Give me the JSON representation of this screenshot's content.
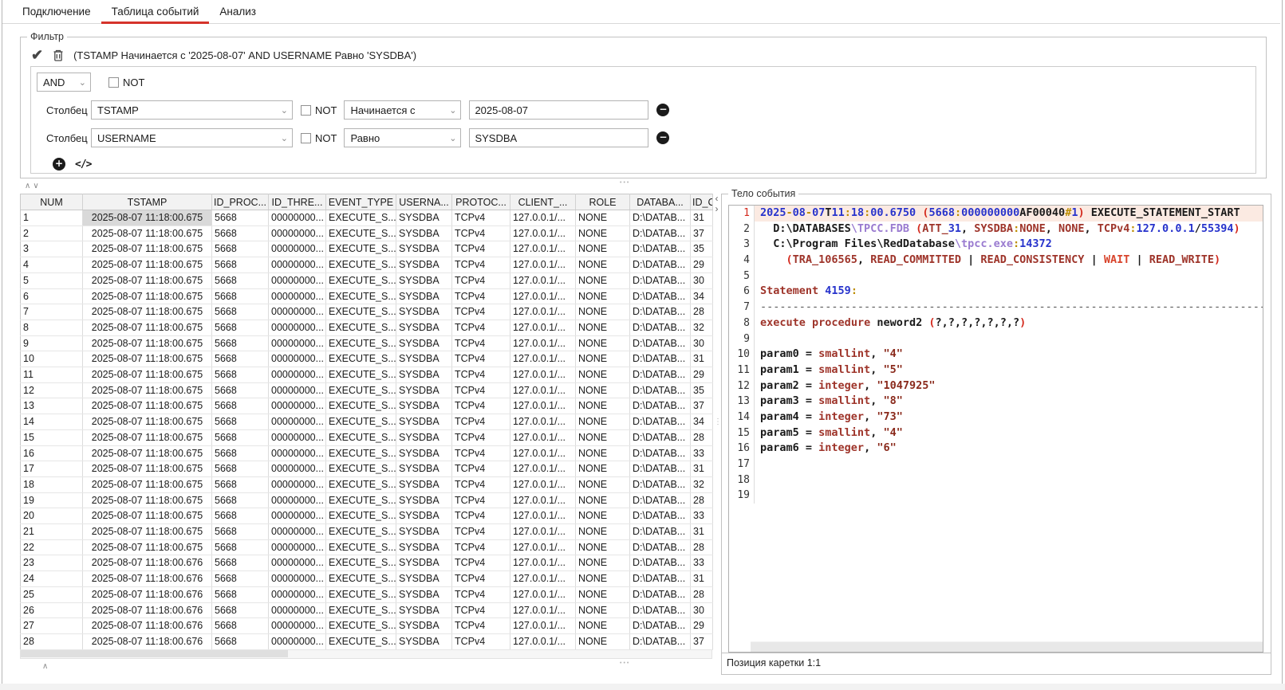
{
  "colors": {
    "tab_accent": "#d5332b",
    "selected_cell_bg": "#d9d9d9",
    "line_highlight_bg": "#fbeae2",
    "syntax": {
      "number": "#2733cc",
      "punct": "#bd8d00",
      "paren": "#d42a1e",
      "keyword": "#9e342a",
      "string": "#8a2a1c",
      "path": "#9a7bd0",
      "warn": "#d8442c",
      "plain": "#1a1a1a",
      "dash": "#555555"
    }
  },
  "icons": {
    "apply": "✔",
    "chevron": "⌄",
    "minus": "−",
    "plus": "+",
    "code": "</>",
    "collapse_up": "∧",
    "collapse_down": "∨",
    "collapse_left": "‹",
    "collapse_right": "›",
    "dots_h": "•••",
    "dots_v": "⋮"
  },
  "tabs": [
    {
      "label": "Подключение",
      "active": false
    },
    {
      "label": "Таблица событий",
      "active": true
    },
    {
      "label": "Анализ",
      "active": false
    }
  ],
  "filter": {
    "legend": "Фильтр",
    "expression": "(TSTAMP Начинается с '2025-08-07' AND USERNAME Равно 'SYSDBA')",
    "group_operator": "AND",
    "not_label": "NOT",
    "column_label": "Столбец",
    "conditions": [
      {
        "column": "TSTAMP",
        "not": false,
        "operator": "Начинается с",
        "value": "2025-08-07"
      },
      {
        "column": "USERNAME",
        "not": false,
        "operator": "Равно",
        "value": "SYSDBA"
      }
    ]
  },
  "table": {
    "columns": [
      "NUM",
      "TSTAMP",
      "ID_PROC...",
      "ID_THRE...",
      "EVENT_TYPE",
      "USERNA...",
      "PROTOC...",
      "CLIENT_...",
      "ROLE",
      "DATABA...",
      "ID_C"
    ],
    "selected_cell": {
      "row": 1,
      "column": "TSTAMP"
    },
    "rows": [
      [
        "1",
        "2025-08-07 11:18:00.675",
        "5668",
        "00000000...",
        "EXECUTE_S...",
        "SYSDBA",
        "TCPv4",
        "127.0.0.1/...",
        "NONE",
        "D:\\DATAB...",
        "31"
      ],
      [
        "2",
        "2025-08-07 11:18:00.675",
        "5668",
        "00000000...",
        "EXECUTE_S...",
        "SYSDBA",
        "TCPv4",
        "127.0.0.1/...",
        "NONE",
        "D:\\DATAB...",
        "37"
      ],
      [
        "3",
        "2025-08-07 11:18:00.675",
        "5668",
        "00000000...",
        "EXECUTE_S...",
        "SYSDBA",
        "TCPv4",
        "127.0.0.1/...",
        "NONE",
        "D:\\DATAB...",
        "35"
      ],
      [
        "4",
        "2025-08-07 11:18:00.675",
        "5668",
        "00000000...",
        "EXECUTE_S...",
        "SYSDBA",
        "TCPv4",
        "127.0.0.1/...",
        "NONE",
        "D:\\DATAB...",
        "29"
      ],
      [
        "5",
        "2025-08-07 11:18:00.675",
        "5668",
        "00000000...",
        "EXECUTE_S...",
        "SYSDBA",
        "TCPv4",
        "127.0.0.1/...",
        "NONE",
        "D:\\DATAB...",
        "30"
      ],
      [
        "6",
        "2025-08-07 11:18:00.675",
        "5668",
        "00000000...",
        "EXECUTE_S...",
        "SYSDBA",
        "TCPv4",
        "127.0.0.1/...",
        "NONE",
        "D:\\DATAB...",
        "34"
      ],
      [
        "7",
        "2025-08-07 11:18:00.675",
        "5668",
        "00000000...",
        "EXECUTE_S...",
        "SYSDBA",
        "TCPv4",
        "127.0.0.1/...",
        "NONE",
        "D:\\DATAB...",
        "28"
      ],
      [
        "8",
        "2025-08-07 11:18:00.675",
        "5668",
        "00000000...",
        "EXECUTE_S...",
        "SYSDBA",
        "TCPv4",
        "127.0.0.1/...",
        "NONE",
        "D:\\DATAB...",
        "32"
      ],
      [
        "9",
        "2025-08-07 11:18:00.675",
        "5668",
        "00000000...",
        "EXECUTE_S...",
        "SYSDBA",
        "TCPv4",
        "127.0.0.1/...",
        "NONE",
        "D:\\DATAB...",
        "30"
      ],
      [
        "10",
        "2025-08-07 11:18:00.675",
        "5668",
        "00000000...",
        "EXECUTE_S...",
        "SYSDBA",
        "TCPv4",
        "127.0.0.1/...",
        "NONE",
        "D:\\DATAB...",
        "31"
      ],
      [
        "11",
        "2025-08-07 11:18:00.675",
        "5668",
        "00000000...",
        "EXECUTE_S...",
        "SYSDBA",
        "TCPv4",
        "127.0.0.1/...",
        "NONE",
        "D:\\DATAB...",
        "29"
      ],
      [
        "12",
        "2025-08-07 11:18:00.675",
        "5668",
        "00000000...",
        "EXECUTE_S...",
        "SYSDBA",
        "TCPv4",
        "127.0.0.1/...",
        "NONE",
        "D:\\DATAB...",
        "35"
      ],
      [
        "13",
        "2025-08-07 11:18:00.675",
        "5668",
        "00000000...",
        "EXECUTE_S...",
        "SYSDBA",
        "TCPv4",
        "127.0.0.1/...",
        "NONE",
        "D:\\DATAB...",
        "37"
      ],
      [
        "14",
        "2025-08-07 11:18:00.675",
        "5668",
        "00000000...",
        "EXECUTE_S...",
        "SYSDBA",
        "TCPv4",
        "127.0.0.1/...",
        "NONE",
        "D:\\DATAB...",
        "34"
      ],
      [
        "15",
        "2025-08-07 11:18:00.675",
        "5668",
        "00000000...",
        "EXECUTE_S...",
        "SYSDBA",
        "TCPv4",
        "127.0.0.1/...",
        "NONE",
        "D:\\DATAB...",
        "28"
      ],
      [
        "16",
        "2025-08-07 11:18:00.675",
        "5668",
        "00000000...",
        "EXECUTE_S...",
        "SYSDBA",
        "TCPv4",
        "127.0.0.1/...",
        "NONE",
        "D:\\DATAB...",
        "33"
      ],
      [
        "17",
        "2025-08-07 11:18:00.675",
        "5668",
        "00000000...",
        "EXECUTE_S...",
        "SYSDBA",
        "TCPv4",
        "127.0.0.1/...",
        "NONE",
        "D:\\DATAB...",
        "31"
      ],
      [
        "18",
        "2025-08-07 11:18:00.675",
        "5668",
        "00000000...",
        "EXECUTE_S...",
        "SYSDBA",
        "TCPv4",
        "127.0.0.1/...",
        "NONE",
        "D:\\DATAB...",
        "32"
      ],
      [
        "19",
        "2025-08-07 11:18:00.675",
        "5668",
        "00000000...",
        "EXECUTE_S...",
        "SYSDBA",
        "TCPv4",
        "127.0.0.1/...",
        "NONE",
        "D:\\DATAB...",
        "28"
      ],
      [
        "20",
        "2025-08-07 11:18:00.675",
        "5668",
        "00000000...",
        "EXECUTE_S...",
        "SYSDBA",
        "TCPv4",
        "127.0.0.1/...",
        "NONE",
        "D:\\DATAB...",
        "33"
      ],
      [
        "21",
        "2025-08-07 11:18:00.675",
        "5668",
        "00000000...",
        "EXECUTE_S...",
        "SYSDBA",
        "TCPv4",
        "127.0.0.1/...",
        "NONE",
        "D:\\DATAB...",
        "31"
      ],
      [
        "22",
        "2025-08-07 11:18:00.675",
        "5668",
        "00000000...",
        "EXECUTE_S...",
        "SYSDBA",
        "TCPv4",
        "127.0.0.1/...",
        "NONE",
        "D:\\DATAB...",
        "28"
      ],
      [
        "23",
        "2025-08-07 11:18:00.676",
        "5668",
        "00000000...",
        "EXECUTE_S...",
        "SYSDBA",
        "TCPv4",
        "127.0.0.1/...",
        "NONE",
        "D:\\DATAB...",
        "33"
      ],
      [
        "24",
        "2025-08-07 11:18:00.676",
        "5668",
        "00000000...",
        "EXECUTE_S...",
        "SYSDBA",
        "TCPv4",
        "127.0.0.1/...",
        "NONE",
        "D:\\DATAB...",
        "31"
      ],
      [
        "25",
        "2025-08-07 11:18:00.676",
        "5668",
        "00000000...",
        "EXECUTE_S...",
        "SYSDBA",
        "TCPv4",
        "127.0.0.1/...",
        "NONE",
        "D:\\DATAB...",
        "28"
      ],
      [
        "26",
        "2025-08-07 11:18:00.676",
        "5668",
        "00000000...",
        "EXECUTE_S...",
        "SYSDBA",
        "TCPv4",
        "127.0.0.1/...",
        "NONE",
        "D:\\DATAB...",
        "30"
      ],
      [
        "27",
        "2025-08-07 11:18:00.676",
        "5668",
        "00000000...",
        "EXECUTE_S...",
        "SYSDBA",
        "TCPv4",
        "127.0.0.1/...",
        "NONE",
        "D:\\DATAB...",
        "29"
      ],
      [
        "28",
        "2025-08-07 11:18:00.676",
        "5668",
        "00000000...",
        "EXECUTE_S...",
        "SYSDBA",
        "TCPv4",
        "127.0.0.1/...",
        "NONE",
        "D:\\DATAB...",
        "37"
      ]
    ]
  },
  "event_body": {
    "legend": "Тело события",
    "caret_status": "Позиция каретки 1:1",
    "lines": [
      {
        "n": 1,
        "hl": true,
        "segs": [
          [
            "b",
            "2025"
          ],
          [
            "o",
            "-"
          ],
          [
            "b",
            "08"
          ],
          [
            "o",
            "-"
          ],
          [
            "b",
            "07"
          ],
          [
            "t",
            "T"
          ],
          [
            "b",
            "11"
          ],
          [
            "o",
            ":"
          ],
          [
            "b",
            "18"
          ],
          [
            "o",
            ":"
          ],
          [
            "b",
            "00.6750"
          ],
          [
            "t",
            " "
          ],
          [
            "r",
            "("
          ],
          [
            "b",
            "5668"
          ],
          [
            "o",
            ":"
          ],
          [
            "b",
            "000000000"
          ],
          [
            "t",
            "AF00040"
          ],
          [
            "o",
            "#"
          ],
          [
            "b",
            "1"
          ],
          [
            "r",
            ")"
          ],
          [
            "t",
            " EXECUTE_STATEMENT_START"
          ]
        ]
      },
      {
        "n": 2,
        "hl": false,
        "segs": [
          [
            "t",
            "  D:"
          ],
          [
            "t",
            "\\DATABASES"
          ],
          [
            "p",
            "\\TPCC.FDB"
          ],
          [
            "t",
            " "
          ],
          [
            "r",
            "("
          ],
          [
            "k",
            "ATT_"
          ],
          [
            "b",
            "31"
          ],
          [
            "t",
            ", "
          ],
          [
            "k",
            "SYSDBA"
          ],
          [
            "o",
            ":"
          ],
          [
            "k",
            "NONE"
          ],
          [
            "t",
            ", "
          ],
          [
            "k",
            "NONE"
          ],
          [
            "t",
            ", "
          ],
          [
            "k",
            "TCPv4"
          ],
          [
            "o",
            ":"
          ],
          [
            "b",
            "127.0.0.1"
          ],
          [
            "t",
            "/"
          ],
          [
            "b",
            "55394"
          ],
          [
            "r",
            ")"
          ]
        ]
      },
      {
        "n": 3,
        "hl": false,
        "segs": [
          [
            "t",
            "  C:"
          ],
          [
            "t",
            "\\Program Files"
          ],
          [
            "t",
            "\\RedDatabase"
          ],
          [
            "p",
            "\\tpcc.exe"
          ],
          [
            "o",
            ":"
          ],
          [
            "b",
            "14372"
          ]
        ]
      },
      {
        "n": 4,
        "hl": false,
        "segs": [
          [
            "t",
            "    "
          ],
          [
            "r",
            "("
          ],
          [
            "k",
            "TRA_106565"
          ],
          [
            "t",
            ", "
          ],
          [
            "k",
            "READ_COMMITTED"
          ],
          [
            "t",
            " | "
          ],
          [
            "k",
            "READ_CONSISTENCY"
          ],
          [
            "t",
            " | "
          ],
          [
            "w",
            "WAIT"
          ],
          [
            "t",
            " | "
          ],
          [
            "k",
            "READ_WRITE"
          ],
          [
            "r",
            ")"
          ]
        ]
      },
      {
        "n": 5,
        "hl": false,
        "segs": []
      },
      {
        "n": 6,
        "hl": false,
        "segs": [
          [
            "k",
            "Statement"
          ],
          [
            "t",
            " "
          ],
          [
            "b",
            "4159"
          ],
          [
            "o",
            ":"
          ]
        ]
      },
      {
        "n": 7,
        "hl": false,
        "segs": [
          [
            "d",
            "--------------------------------------------------------------------------------"
          ]
        ]
      },
      {
        "n": 8,
        "hl": false,
        "segs": [
          [
            "k",
            "execute"
          ],
          [
            "t",
            " "
          ],
          [
            "k",
            "procedure"
          ],
          [
            "t",
            " neword2 "
          ],
          [
            "r",
            "("
          ],
          [
            "t",
            "?,?,?,?,?,?,?"
          ],
          [
            "r",
            ")"
          ]
        ]
      },
      {
        "n": 9,
        "hl": false,
        "segs": []
      },
      {
        "n": 10,
        "hl": false,
        "segs": [
          [
            "t",
            "param0 = "
          ],
          [
            "k",
            "smallint"
          ],
          [
            "t",
            ", "
          ],
          [
            "s",
            "\"4\""
          ]
        ]
      },
      {
        "n": 11,
        "hl": false,
        "segs": [
          [
            "t",
            "param1 = "
          ],
          [
            "k",
            "smallint"
          ],
          [
            "t",
            ", "
          ],
          [
            "s",
            "\"5\""
          ]
        ]
      },
      {
        "n": 12,
        "hl": false,
        "segs": [
          [
            "t",
            "param2 = "
          ],
          [
            "k",
            "integer"
          ],
          [
            "t",
            ", "
          ],
          [
            "s",
            "\"1047925\""
          ]
        ]
      },
      {
        "n": 13,
        "hl": false,
        "segs": [
          [
            "t",
            "param3 = "
          ],
          [
            "k",
            "smallint"
          ],
          [
            "t",
            ", "
          ],
          [
            "s",
            "\"8\""
          ]
        ]
      },
      {
        "n": 14,
        "hl": false,
        "segs": [
          [
            "t",
            "param4 = "
          ],
          [
            "k",
            "integer"
          ],
          [
            "t",
            ", "
          ],
          [
            "s",
            "\"73\""
          ]
        ]
      },
      {
        "n": 15,
        "hl": false,
        "segs": [
          [
            "t",
            "param5 = "
          ],
          [
            "k",
            "smallint"
          ],
          [
            "t",
            ", "
          ],
          [
            "s",
            "\"4\""
          ]
        ]
      },
      {
        "n": 16,
        "hl": false,
        "segs": [
          [
            "t",
            "param6 = "
          ],
          [
            "k",
            "integer"
          ],
          [
            "t",
            ", "
          ],
          [
            "s",
            "\"6\""
          ]
        ]
      },
      {
        "n": 17,
        "hl": false,
        "segs": []
      },
      {
        "n": 18,
        "hl": false,
        "segs": []
      },
      {
        "n": 19,
        "hl": false,
        "segs": []
      }
    ]
  }
}
